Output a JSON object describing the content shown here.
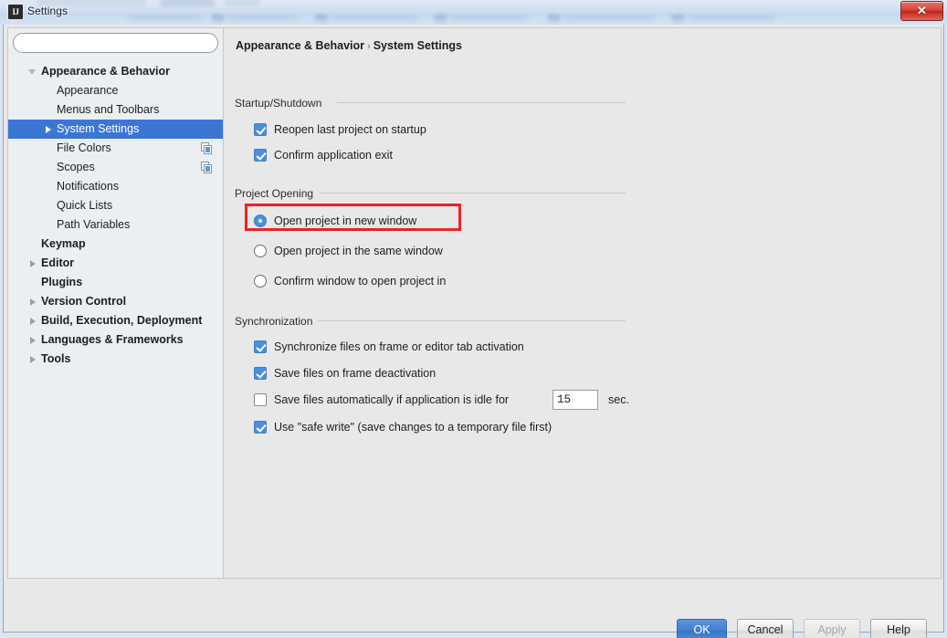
{
  "window": {
    "title": "Settings",
    "app_icon": "IJ",
    "close_label": "✕"
  },
  "search": {
    "value": "",
    "placeholder": "",
    "icon": "search-icon"
  },
  "sidebar": {
    "items": [
      {
        "label": "Appearance & Behavior",
        "level": 0,
        "arrow": "down",
        "selected": false,
        "project_icon": false
      },
      {
        "label": "Appearance",
        "level": 1,
        "arrow": "none",
        "selected": false,
        "project_icon": false
      },
      {
        "label": "Menus and Toolbars",
        "level": 1,
        "arrow": "none",
        "selected": false,
        "project_icon": false
      },
      {
        "label": "System Settings",
        "level": 1,
        "arrow": "right",
        "selected": true,
        "project_icon": false
      },
      {
        "label": "File Colors",
        "level": 1,
        "arrow": "none",
        "selected": false,
        "project_icon": true
      },
      {
        "label": "Scopes",
        "level": 1,
        "arrow": "none",
        "selected": false,
        "project_icon": true
      },
      {
        "label": "Notifications",
        "level": 1,
        "arrow": "none",
        "selected": false,
        "project_icon": false
      },
      {
        "label": "Quick Lists",
        "level": 1,
        "arrow": "none",
        "selected": false,
        "project_icon": false
      },
      {
        "label": "Path Variables",
        "level": 1,
        "arrow": "none",
        "selected": false,
        "project_icon": false
      },
      {
        "label": "Keymap",
        "level": 0,
        "arrow": "none",
        "selected": false,
        "project_icon": false
      },
      {
        "label": "Editor",
        "level": 0,
        "arrow": "right",
        "selected": false,
        "project_icon": false
      },
      {
        "label": "Plugins",
        "level": 0,
        "arrow": "none",
        "selected": false,
        "project_icon": false
      },
      {
        "label": "Version Control",
        "level": 0,
        "arrow": "right",
        "selected": false,
        "project_icon": false
      },
      {
        "label": "Build, Execution, Deployment",
        "level": 0,
        "arrow": "right",
        "selected": false,
        "project_icon": false
      },
      {
        "label": "Languages & Frameworks",
        "level": 0,
        "arrow": "right",
        "selected": false,
        "project_icon": false
      },
      {
        "label": "Tools",
        "level": 0,
        "arrow": "right",
        "selected": false,
        "project_icon": false
      }
    ]
  },
  "breadcrumb": {
    "parent": "Appearance & Behavior",
    "separator": "›",
    "current": "System Settings"
  },
  "sections": {
    "startup": {
      "title": "Startup/Shutdown",
      "options": [
        {
          "label": "Reopen last project on startup",
          "checked": true
        },
        {
          "label": "Confirm application exit",
          "checked": true
        }
      ]
    },
    "project_opening": {
      "title": "Project Opening",
      "options": [
        {
          "label": "Open project in new window",
          "selected": true
        },
        {
          "label": "Open project in the same window",
          "selected": false
        },
        {
          "label": "Confirm window to open project in",
          "selected": false
        }
      ]
    },
    "synchronization": {
      "title": "Synchronization",
      "options": [
        {
          "label": "Synchronize files on frame or editor tab activation",
          "checked": true
        },
        {
          "label": "Save files on frame deactivation",
          "checked": true
        },
        {
          "label": "Save files automatically if application is idle for",
          "checked": false
        },
        {
          "label": "Use \"safe write\" (save changes to a temporary file first)",
          "checked": true
        }
      ],
      "idle_seconds_value": "15",
      "idle_seconds_unit": "sec."
    }
  },
  "buttons": {
    "ok": "OK",
    "cancel": "Cancel",
    "apply": "Apply",
    "help": "Help"
  },
  "colors": {
    "selection_blue": "#3b76d4",
    "control_blue": "#4a8fdb",
    "annotation_red": "#f32020",
    "panel_grey": "#e8e8e8",
    "sidebar_grey": "#eceff1"
  }
}
